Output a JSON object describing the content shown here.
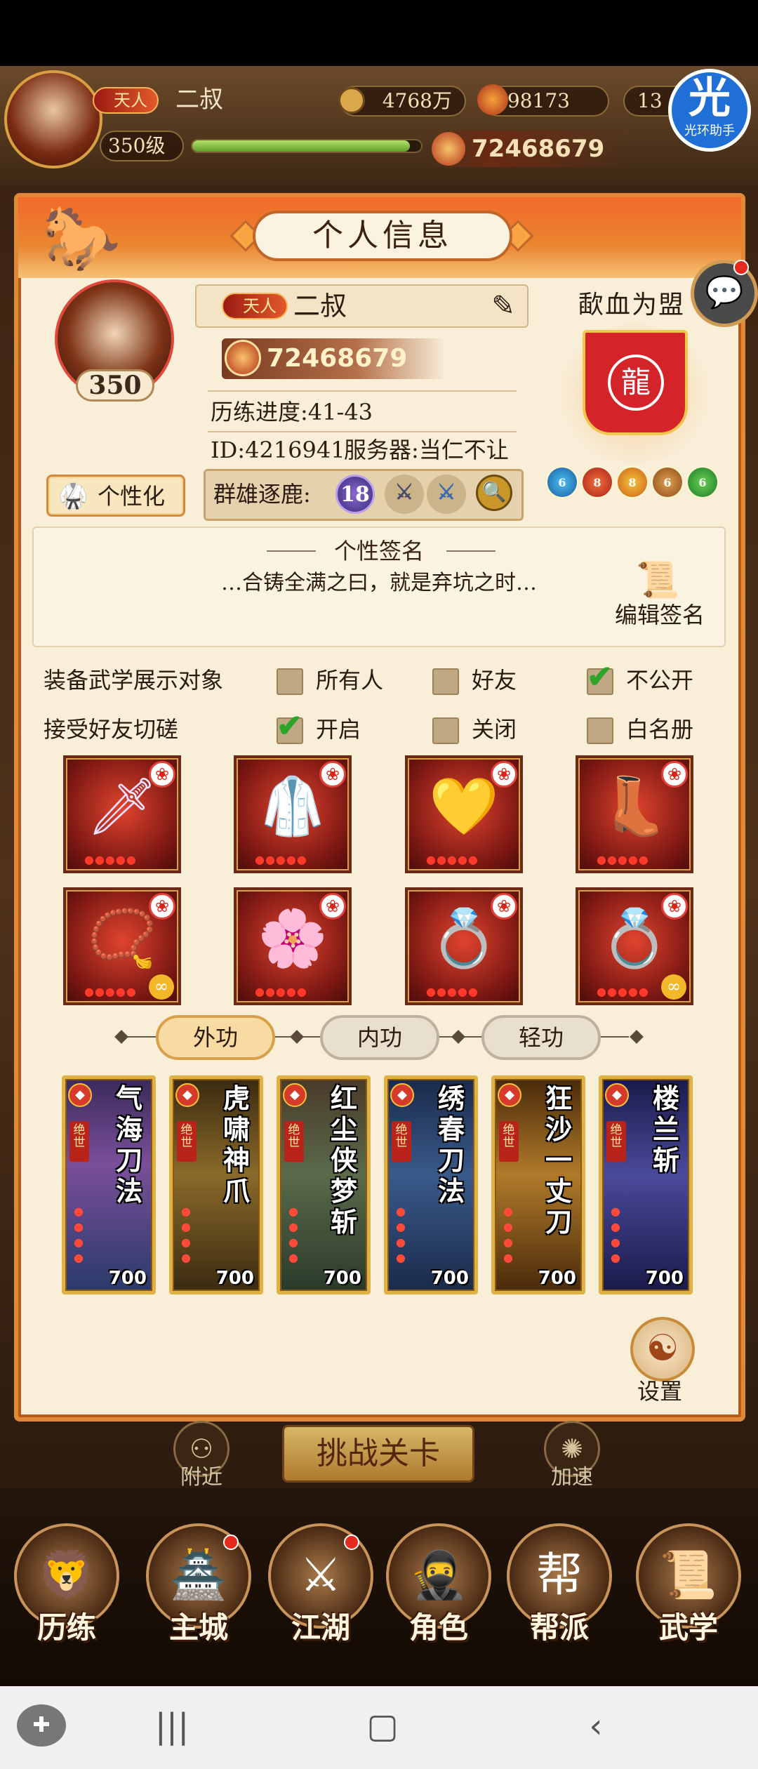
{
  "hud": {
    "rank_tag": "天人",
    "player_name": "二叔",
    "level": "350级",
    "silver": "4768万",
    "gold": "98173",
    "ingot": "13",
    "power": "72468679"
  },
  "helper_badge": {
    "glyph": "光",
    "label": "光环助手"
  },
  "panel": {
    "title": "个人信息",
    "avatar_level": "350",
    "rank_tag": "天人",
    "name": "二叔",
    "power": "72468679",
    "progress": "历练进度:41-43",
    "id_line": "ID:4216941",
    "server_line": "服务器:当仁不让",
    "personalize_label": "个性化",
    "arena_label": "群雄逐鹿:",
    "arena_rank": "18",
    "guild_name": "歃血为盟",
    "guild_orbs": [
      "6",
      "8",
      "8",
      "6",
      "6"
    ]
  },
  "signature": {
    "title": "个性签名",
    "text": "…合铸全满之曰，就是弃坑之时…",
    "edit_label": "编辑签名"
  },
  "options": {
    "display_label": "装备武学展示对象",
    "display_choices": [
      {
        "label": "所有人",
        "checked": false
      },
      {
        "label": "好友",
        "checked": false
      },
      {
        "label": "不公开",
        "checked": true
      }
    ],
    "spar_label": "接受好友切磋",
    "spar_choices": [
      {
        "label": "开启",
        "checked": true
      },
      {
        "label": "关闭",
        "checked": false
      },
      {
        "label": "白名册",
        "checked": false
      }
    ]
  },
  "equipment": [
    {
      "name": "weapon",
      "icon": "sword-icon",
      "glyph": "🗡"
    },
    {
      "name": "robe",
      "icon": "robe-icon",
      "glyph": "🥼"
    },
    {
      "name": "belt",
      "icon": "belt-icon",
      "glyph": "💛"
    },
    {
      "name": "boots",
      "icon": "boots-icon",
      "glyph": "👢"
    },
    {
      "name": "necklace",
      "icon": "necklace-icon",
      "glyph": "📿"
    },
    {
      "name": "hairpin",
      "icon": "hairpin-icon",
      "glyph": "🌸"
    },
    {
      "name": "bracelet",
      "icon": "bracelet-icon",
      "glyph": "💍"
    },
    {
      "name": "ring",
      "icon": "ring-icon",
      "glyph": "💍"
    }
  ],
  "tabs": [
    "外功",
    "内功",
    "轻功"
  ],
  "skills": [
    {
      "name": "气海刀法",
      "rank": "绝世",
      "power": "700"
    },
    {
      "name": "虎啸神爪",
      "rank": "绝世",
      "power": "700"
    },
    {
      "name": "红尘侠梦斩",
      "rank": "绝世",
      "power": "700"
    },
    {
      "name": "绣春刀法",
      "rank": "绝世",
      "power": "700"
    },
    {
      "name": "狂沙一丈刀",
      "rank": "绝世",
      "power": "700"
    },
    {
      "name": "楼兰斩",
      "rank": "绝世",
      "power": "700"
    }
  ],
  "settings_label": "设置",
  "challenge_label": "挑战关卡",
  "nearby_label": "附近",
  "speed_label": "加速",
  "nav": [
    "历练",
    "主城",
    "江湖",
    "角色",
    "帮派",
    "武学"
  ]
}
